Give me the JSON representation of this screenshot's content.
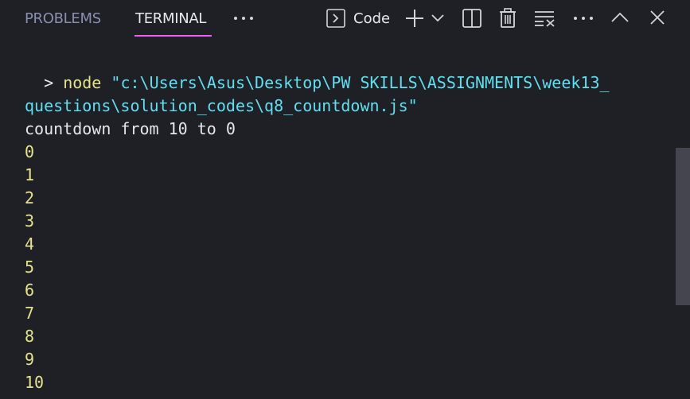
{
  "tabs": {
    "problems": "PROBLEMS",
    "terminal": "TERMINAL"
  },
  "toolbar": {
    "terminal_name": "Code",
    "icons": [
      "more-icon",
      "terminal-icon",
      "plus-icon",
      "chevron-down-icon",
      "split-icon",
      "trash-icon",
      "clear-icon",
      "more-icon",
      "chevron-up-icon",
      "close-icon"
    ]
  },
  "terminal": {
    "prompt": ">",
    "command": "node",
    "path_line1": "\"c:\\Users\\Asus\\Desktop\\PW SKILLS\\ASSIGNMENTS\\week13_",
    "path_line2": "questions\\solution_codes\\q8_countdown.js\"",
    "output_header": "countdown from 10 to 0",
    "output_lines": [
      "0",
      "1",
      "2",
      "3",
      "4",
      "5",
      "6",
      "7",
      "8",
      "9",
      "10"
    ]
  },
  "colors": {
    "background": "#1f1f26",
    "active_tab_underline": "#ec5ff0",
    "command": "#e6e38a",
    "path": "#5ee0f0",
    "output": "#e6e6ea"
  }
}
